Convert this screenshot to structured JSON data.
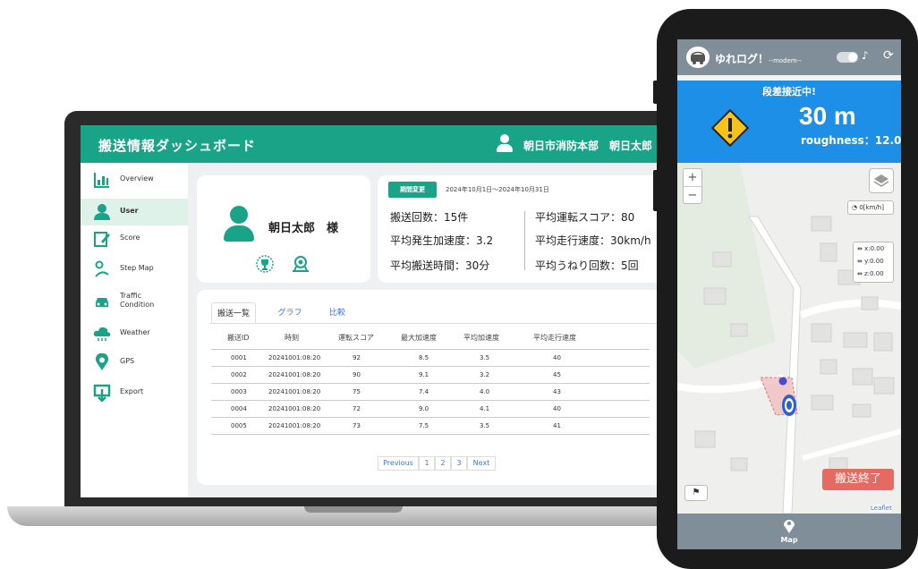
{
  "dashboard": {
    "title": "搬送情報ダッシュボード",
    "org": "朝日市消防本部　朝日太郎",
    "sidebar": [
      {
        "label": "Overview",
        "icon": "chart-icon"
      },
      {
        "label": "User",
        "icon": "user-icon",
        "active": true
      },
      {
        "label": "Score",
        "icon": "edit-icon"
      },
      {
        "label": "Step Map",
        "icon": "route-icon"
      },
      {
        "label": "Traffic Condition",
        "line1": "Traffic",
        "line2": "Condition",
        "icon": "car-icon"
      },
      {
        "label": "Weather",
        "icon": "cloud-icon"
      },
      {
        "label": "GPS",
        "icon": "location-icon"
      },
      {
        "label": "Export",
        "icon": "export-icon"
      }
    ],
    "profile": {
      "name": "朝日太郎　様"
    },
    "period": {
      "button": "期間変更",
      "range": "2024年10月1日～2024年10月31日"
    },
    "stats": [
      "搬送回数：15件",
      "平均運転スコア：80",
      "平均発生加速度：3.2",
      "平均走行速度：30km/h",
      "平均搬送時間：30分",
      "平均うねり回数：5回"
    ],
    "tabs": [
      "搬送一覧",
      "グラフ",
      "比較"
    ],
    "columns": [
      "搬送ID",
      "時刻",
      "運転スコア",
      "最大加速度",
      "平均加速度",
      "平均走行速度"
    ],
    "rows": [
      [
        "0001",
        "20241001:08:20",
        "92",
        "8.5",
        "3.5",
        "40"
      ],
      [
        "0002",
        "20241001:08:20",
        "90",
        "9.1",
        "3.2",
        "45"
      ],
      [
        "0003",
        "20241001:08:20",
        "75",
        "7.4",
        "4.0",
        "43"
      ],
      [
        "0004",
        "20241001:08:20",
        "72",
        "9.0",
        "4.1",
        "40"
      ],
      [
        "0005",
        "20241001:08:20",
        "73",
        "7.5",
        "3.5",
        "41"
      ]
    ],
    "pager": {
      "prev": "Previous",
      "pages": [
        "1",
        "2",
        "3"
      ],
      "next": "Next"
    }
  },
  "phone": {
    "app_title": "ゆれログ！",
    "app_subtitle": "--modem--",
    "alert_title": "段差接近中!",
    "alert_distance": "30 m",
    "alert_roughness": "roughness：12.0",
    "zoom_in": "+",
    "zoom_out": "−",
    "speed": "0[km/h]",
    "axis": [
      "x:0.00",
      "y:0.00",
      "z:0.00"
    ],
    "end_button": "搬送終了",
    "leaflet": "Leaflet",
    "nav_label": "Map"
  },
  "colors": {
    "brand_green": "#1aa487",
    "alert_blue": "#1e8fe6",
    "end_red": "#e36b62",
    "app_bar": "#7f8e98"
  }
}
